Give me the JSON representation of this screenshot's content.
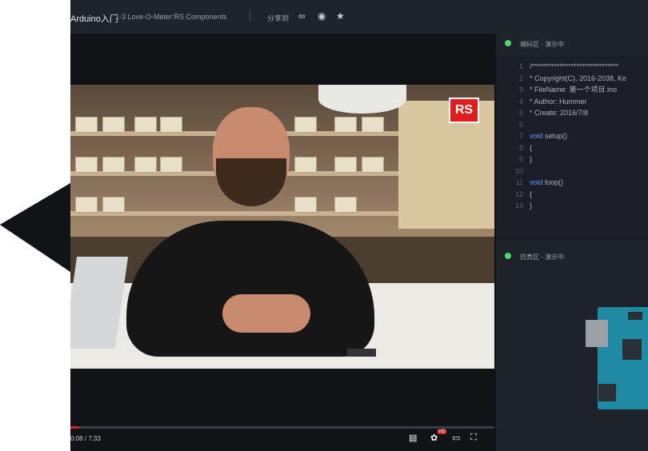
{
  "header": {
    "course_title": "Arduino入门",
    "lesson_title": "1-3 Love-O-Meter:RS Components",
    "share_label": "分享到",
    "share_icons": [
      "link-icon",
      "weibo-icon",
      "star-icon"
    ]
  },
  "video": {
    "time_display": "0:08 / 7:33",
    "progress_fraction": 0.02,
    "logo_text": "RS",
    "controls": [
      "subtitles-icon",
      "settings-icon",
      "theater-icon",
      "fullscreen-icon"
    ],
    "hd_badge": "HD"
  },
  "editor": {
    "label": "编码区 - 演示中",
    "lines": [
      {
        "num": "1",
        "text": "/*******************************"
      },
      {
        "num": "2",
        "text": " * Copyright(C), 2016-2038, Ke"
      },
      {
        "num": "3",
        "text": " * FileName: 第一个项目.ino"
      },
      {
        "num": "4",
        "text": " * Author: Hummer"
      },
      {
        "num": "5",
        "text": " * Create: 2016/7/8"
      },
      {
        "num": "6",
        "text": ""
      },
      {
        "num": "7",
        "kw": "void",
        "text": " setup()"
      },
      {
        "num": "8",
        "text": "{"
      },
      {
        "num": "9",
        "text": "}"
      },
      {
        "num": "10",
        "text": ""
      },
      {
        "num": "11",
        "kw": "void",
        "text": " loop()"
      },
      {
        "num": "12",
        "text": "{"
      },
      {
        "num": "13",
        "text": "}"
      }
    ]
  },
  "simulator": {
    "label": "仿真区 - 演示中"
  },
  "colors": {
    "status_green": "#4cd964",
    "accent_red": "#e02020",
    "keyword_blue": "#5f9bff"
  }
}
